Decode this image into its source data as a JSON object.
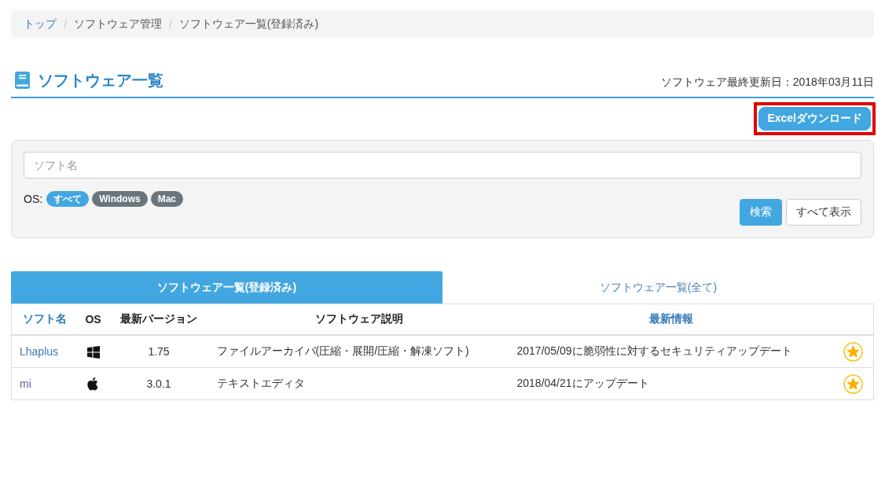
{
  "breadcrumb": {
    "items": [
      {
        "label": "トップ",
        "link": true
      },
      {
        "separator": "/",
        "label": "ソフトウェア管理",
        "link": false
      },
      {
        "separator": "/",
        "label": "ソフトウェア一覧(登録済み)",
        "link": false
      }
    ]
  },
  "page_title": "ソフトウェア一覧",
  "last_updated": "ソフトウェア最終更新日：2018年03月11日",
  "excel_button": {
    "label": "Excelダウンロード",
    "highlighted": true
  },
  "search": {
    "placeholder": "ソフト名",
    "os_label": "OS:",
    "os_filters": [
      {
        "label": "すべて",
        "selected": true
      },
      {
        "label": "Windows",
        "selected": false
      },
      {
        "label": "Mac",
        "selected": false
      }
    ],
    "buttons": [
      {
        "label": "検索",
        "kind": "primary"
      },
      {
        "label": "すべて表示",
        "kind": "default"
      }
    ]
  },
  "tabs": [
    {
      "label": "ソフトウェア一覧(登録済み)",
      "selected": true
    },
    {
      "label": "ソフトウェア一覧(全て)",
      "selected": false
    }
  ],
  "table": {
    "columns": [
      {
        "label": "ソフト名",
        "sortable": true
      },
      {
        "label": "OS",
        "sortable": false
      },
      {
        "label": "最新バージョン",
        "sortable": false
      },
      {
        "label": "ソフトウェア説明",
        "sortable": false
      },
      {
        "label": "最新情報",
        "sortable": true
      }
    ],
    "rows": [
      {
        "kind": "windows",
        "name": "Lhaplus",
        "visited": false,
        "version": "1.75",
        "description": "ファイルアーカイバ(圧縮・展開/圧縮・解凍ソフト)",
        "latest_info": "2017/05/09に脆弱性に対するセキュリティアップデート",
        "starred": true
      },
      {
        "kind": "mac",
        "name": "mi",
        "visited": true,
        "version": "3.0.1",
        "description": "テキストエディタ",
        "latest_info": "2018/04/21にアップデート",
        "starred": true
      }
    ]
  }
}
